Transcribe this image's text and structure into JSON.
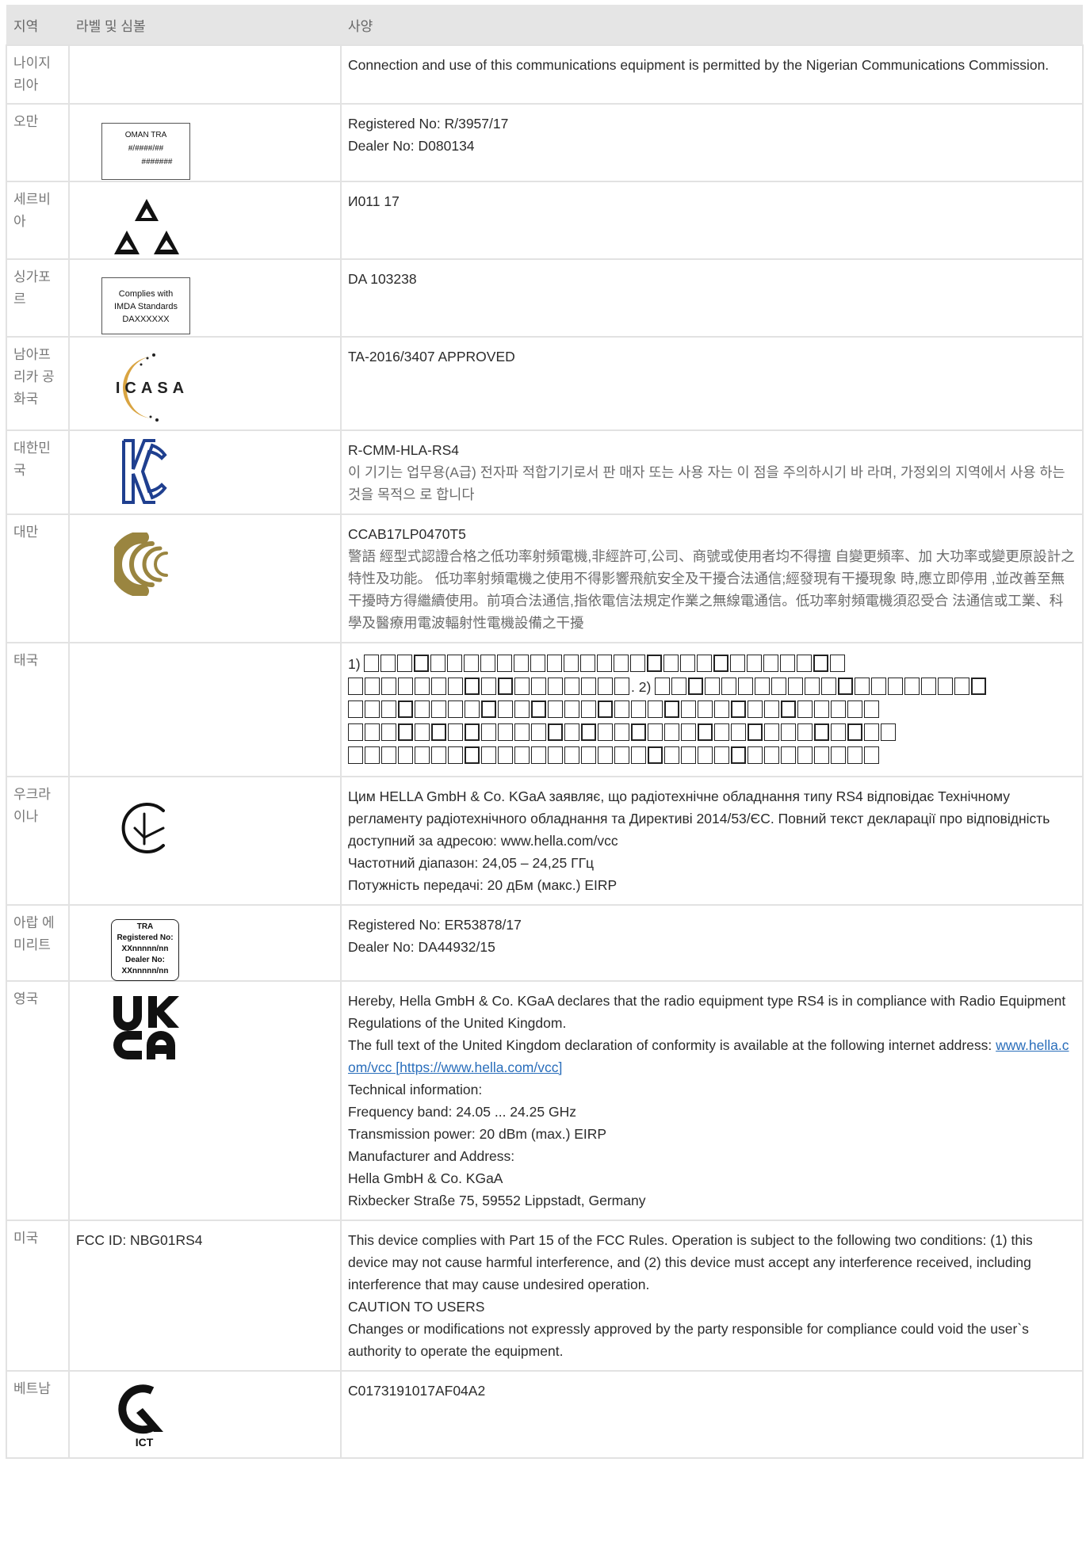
{
  "header": {
    "region": "지역",
    "label": "라벨 및 심볼",
    "spec": "사양"
  },
  "rows": {
    "nigeria": {
      "region": "나이지리아",
      "spec": [
        "Connection and use of this communications equipment is permitted by the Nigerian Communications Commission."
      ]
    },
    "oman": {
      "region": "오만",
      "label_lines": [
        "OMAN TRA",
        "#/####/##",
        "#######"
      ],
      "spec": [
        "Registered No: R/3957/17",
        "Dealer No: D080134"
      ]
    },
    "serbia": {
      "region": "세르비아",
      "spec": [
        "И011 17"
      ]
    },
    "singapore": {
      "region": "싱가포르",
      "label_lines": [
        "Complies with",
        "IMDA Standards",
        "DAXXXXXX"
      ],
      "spec": [
        "DA 103238"
      ]
    },
    "south_africa": {
      "region": "남아프리카 공화국",
      "label_logo": "ICASA",
      "spec": [
        "TA-2016/3407 APPROVED"
      ]
    },
    "korea": {
      "region": "대한민국",
      "spec": [
        "R-CMM-HLA-RS4",
        "이 기기는 업무용(A급) 전자파 적합기기로서 판 매자 또는 사용 자는 이 점을 주의하시기 바 라며, 가정외의 지역에서 사용 하는 것을 목적으 로 합니다"
      ]
    },
    "taiwan": {
      "region": "대만",
      "spec": [
        "CCAB17LP0470T5",
        "警語 經型式認證合格之低功率射頻電機,非經許可,公司、商號或使用者均不得擅 自變更頻率、加 大功率或變更原設計之特性及功能。 低功率射頻電機之使用不得影響飛航安全及干擾合法通信;經發現有干擾現象 時,應立即停用 ,並改善至無干擾時方得繼續使用。前項合法通信,指依電信法規定作業之無線電通信。低功率射頻電機須忍受合 法通信或工業、科學及醫療用電波輻射性電機設備之干擾"
      ]
    },
    "thailand": {
      "region": "태국",
      "thai_prefix": "1)",
      "thai_mid": ". 2)"
    },
    "ukraine": {
      "region": "우크라이나",
      "spec": [
        "Цим HELLA GmbH & Co. KGaA заявляє, що радіотехнічне обладнання типу RS4 відповідає Технічному регламенту радіотехнічного обладнання та Директиві 2014/53/ЄС. Повний текст декларації про відповідність доступний за адресою: www.hella.com/vcc",
        "Частотний діапазон: 24,05 – 24,25 ГГц",
        "Потужність передачі: 20 дБм (макс.) EIRP"
      ]
    },
    "uae": {
      "region": "아랍 에미리트",
      "label_lines": [
        "TRA",
        "Registered No:",
        "XXnnnnn/nn",
        "Dealer No:",
        "XXnnnnn/nn"
      ],
      "spec": [
        "Registered No: ER53878/17",
        "Dealer No: DA44932/15"
      ]
    },
    "uk": {
      "region": "영국",
      "label_logo": [
        "UK",
        "CA"
      ],
      "spec_before_link": [
        "Hereby, Hella GmbH & Co. KGaA declares that the radio equipment type RS4 is in compliance with Radio Equipment Regulations of the United Kingdom."
      ],
      "spec_link_prefix": "The full text of the United Kingdom declaration of conformity is available at the following internet address: ",
      "spec_link_text": "www.hella.com/vcc [https://www.hella.com/vcc]",
      "spec_after_link": [
        "Technical information:",
        "Frequency band: 24.05 ... 24.25 GHz",
        "Transmission power: 20 dBm (max.) EIRP",
        "Manufacturer and Address:",
        "Hella GmbH & Co. KGaA",
        "Rixbecker Straße 75, 59552 Lippstadt, Germany"
      ]
    },
    "usa": {
      "region": "미국",
      "label_text": "FCC ID: NBG01RS4",
      "spec": [
        "This device complies with Part 15 of the FCC Rules. Operation is subject to the following two conditions: (1) this device may not cause harmful interference, and (2) this device must accept any interference received, including interference that may cause undesired operation.",
        "CAUTION TO USERS",
        "Changes or modifications not expressly approved by the party responsible for compliance could void the user`s authority to operate the equipment."
      ]
    },
    "vietnam": {
      "region": "베트남",
      "label_logo": "ICT",
      "spec": [
        "C0173191017AF04A2"
      ]
    }
  },
  "colors": {
    "header_bg": "#e5e5e5",
    "border": "#e2e2e2",
    "link": "#2a6ebb",
    "kc_blue": "#1f3f8f",
    "taiwan_gold": "#9a8540",
    "icasa_gold": "#d9a441"
  },
  "icons": {
    "serbia": "triangle-triple-icon",
    "south_africa": "icasa-logo",
    "korea": "kc-mark-icon",
    "taiwan": "ncc-mark-icon",
    "ukraine": "ukraine-conformity-icon",
    "uk": "ukca-mark-icon",
    "vietnam": "ict-mark-icon"
  }
}
